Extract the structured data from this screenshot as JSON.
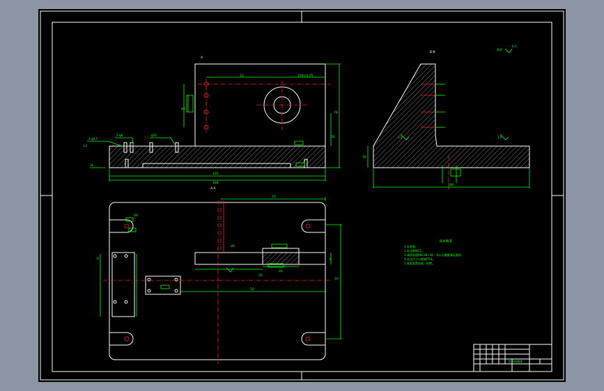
{
  "colors": {
    "background": "#8b95a3",
    "sheet": "#000000",
    "outline": "#ffffff",
    "dimension": "#00ff00",
    "centerline": "#ff2020"
  },
  "views": {
    "front_label": "A",
    "side_label": "B-B",
    "top_label": "A-A"
  },
  "dims": {
    "d15": "15",
    "d100": "100±0.05",
    "d120": "120",
    "d188": "188",
    "d78": "78",
    "d10": "10",
    "d8": "8",
    "d20": "20",
    "d25": "25",
    "d28": "28",
    "d56": "56",
    "d50": "50",
    "d40": "40",
    "d30": "30",
    "d70": "70",
    "dR6": "R6",
    "d4h": "4-φ6.5",
    "d2h": "2-φ8",
    "d6": "6",
    "dphi": "φ10",
    "d16": "16",
    "d180": "180"
  },
  "roughness": {
    "r32": "3.2",
    "r16": "1.6",
    "r63": "6.3",
    "other": "其余"
  },
  "notes": {
    "title": "技术要求",
    "lines": [
      "1.去毛刺。",
      "2.未注倒角C1。",
      "3.调质处理HRC28~32，淬火后硬度满足要求。",
      "4.未注尺寸公差按IT14。",
      "5.表面发黑处理，防锈。"
    ]
  },
  "title_block": {
    "part": "定位夹具体"
  }
}
